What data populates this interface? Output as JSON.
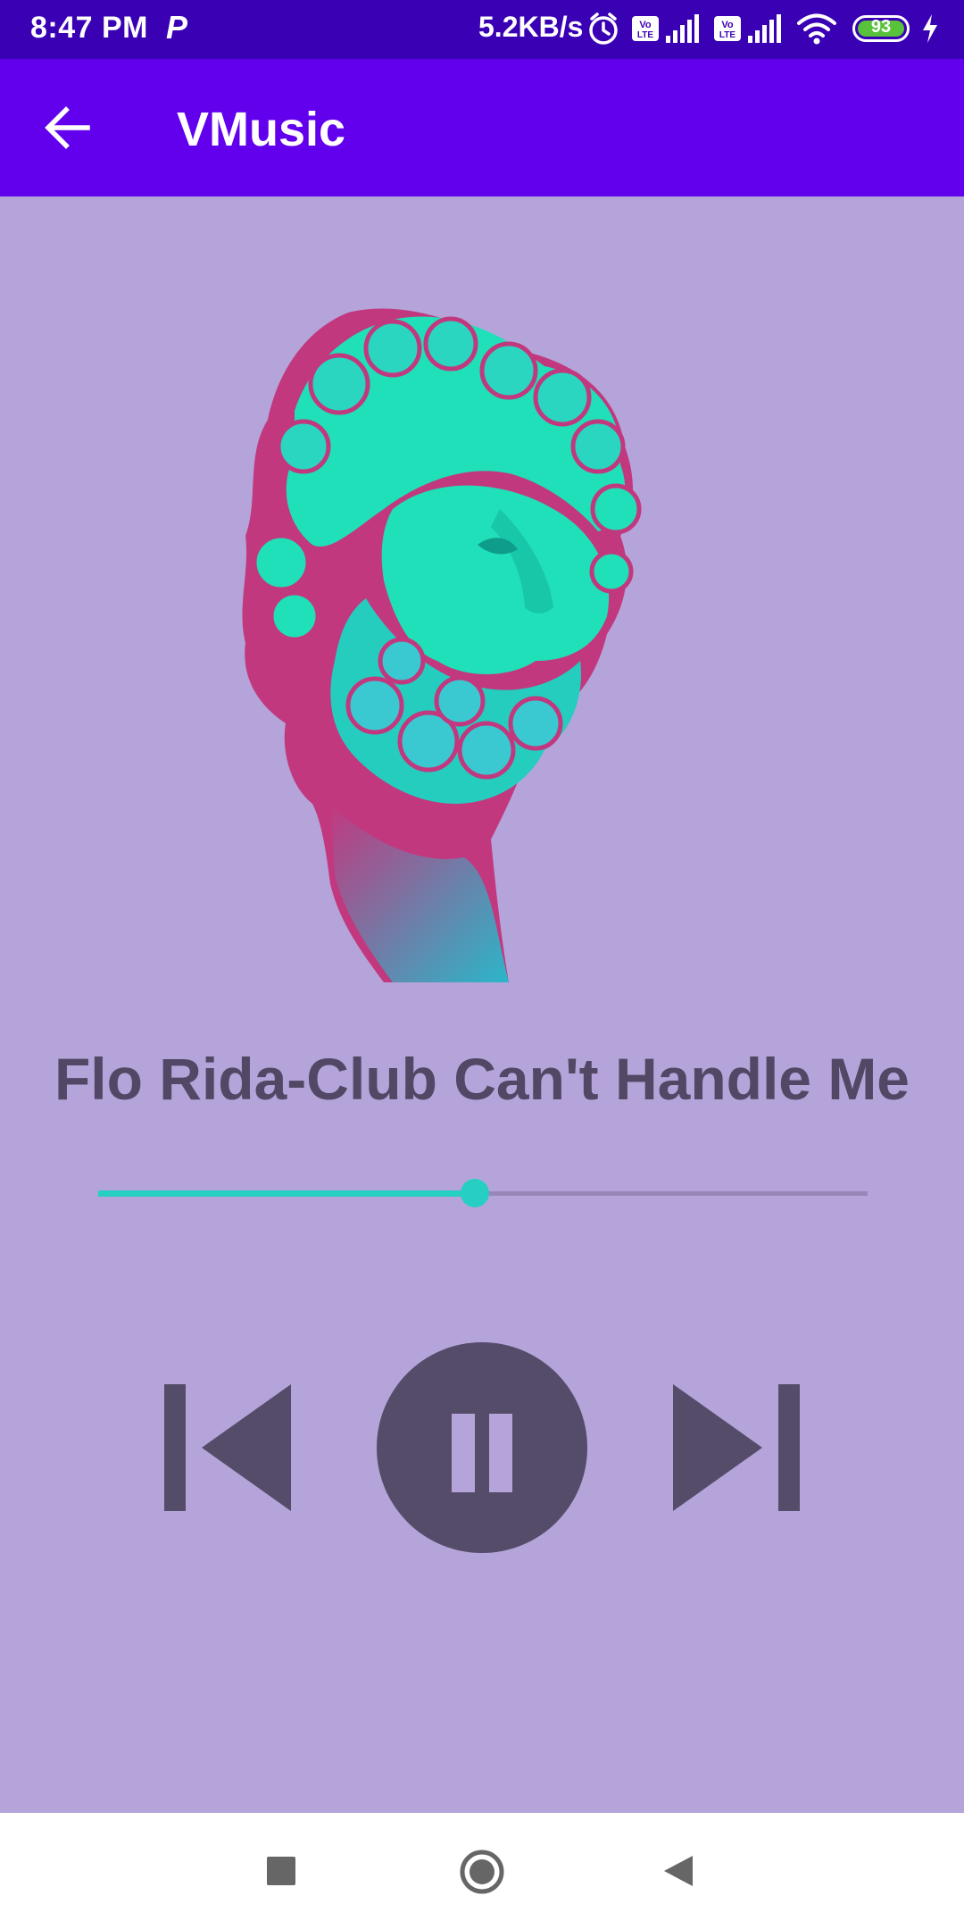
{
  "status_bar": {
    "time": "8:47 PM",
    "app_indicator": "P",
    "network_speed": "5.2KB/s",
    "battery_level": "93",
    "icons": [
      "alarm-icon",
      "volte-icon",
      "signal-icon",
      "volte-icon",
      "signal-icon",
      "wifi-icon",
      "battery-icon",
      "charging-icon"
    ]
  },
  "app_bar": {
    "back_icon": "arrow-back-icon",
    "title": "VMusic"
  },
  "player": {
    "artwork_icon": "album-art-statue",
    "song_title": "Flo Rida-Club Can't Handle Me",
    "progress": 0.49,
    "controls": {
      "previous_icon": "skip-previous-icon",
      "play_pause_icon": "pause-icon",
      "next_icon": "skip-next-icon"
    }
  },
  "nav_bar": {
    "icons": [
      "recents-square-icon",
      "home-circle-icon",
      "back-triangle-icon"
    ]
  },
  "colors": {
    "status_bar": "#3a00b4",
    "app_bar": "#6200ee",
    "background": "#b5a4da",
    "accent": "#27cfc2",
    "controls": "#554c6a",
    "artwork_teal": "#1fe0b8",
    "artwork_magenta": "#c2387f"
  }
}
